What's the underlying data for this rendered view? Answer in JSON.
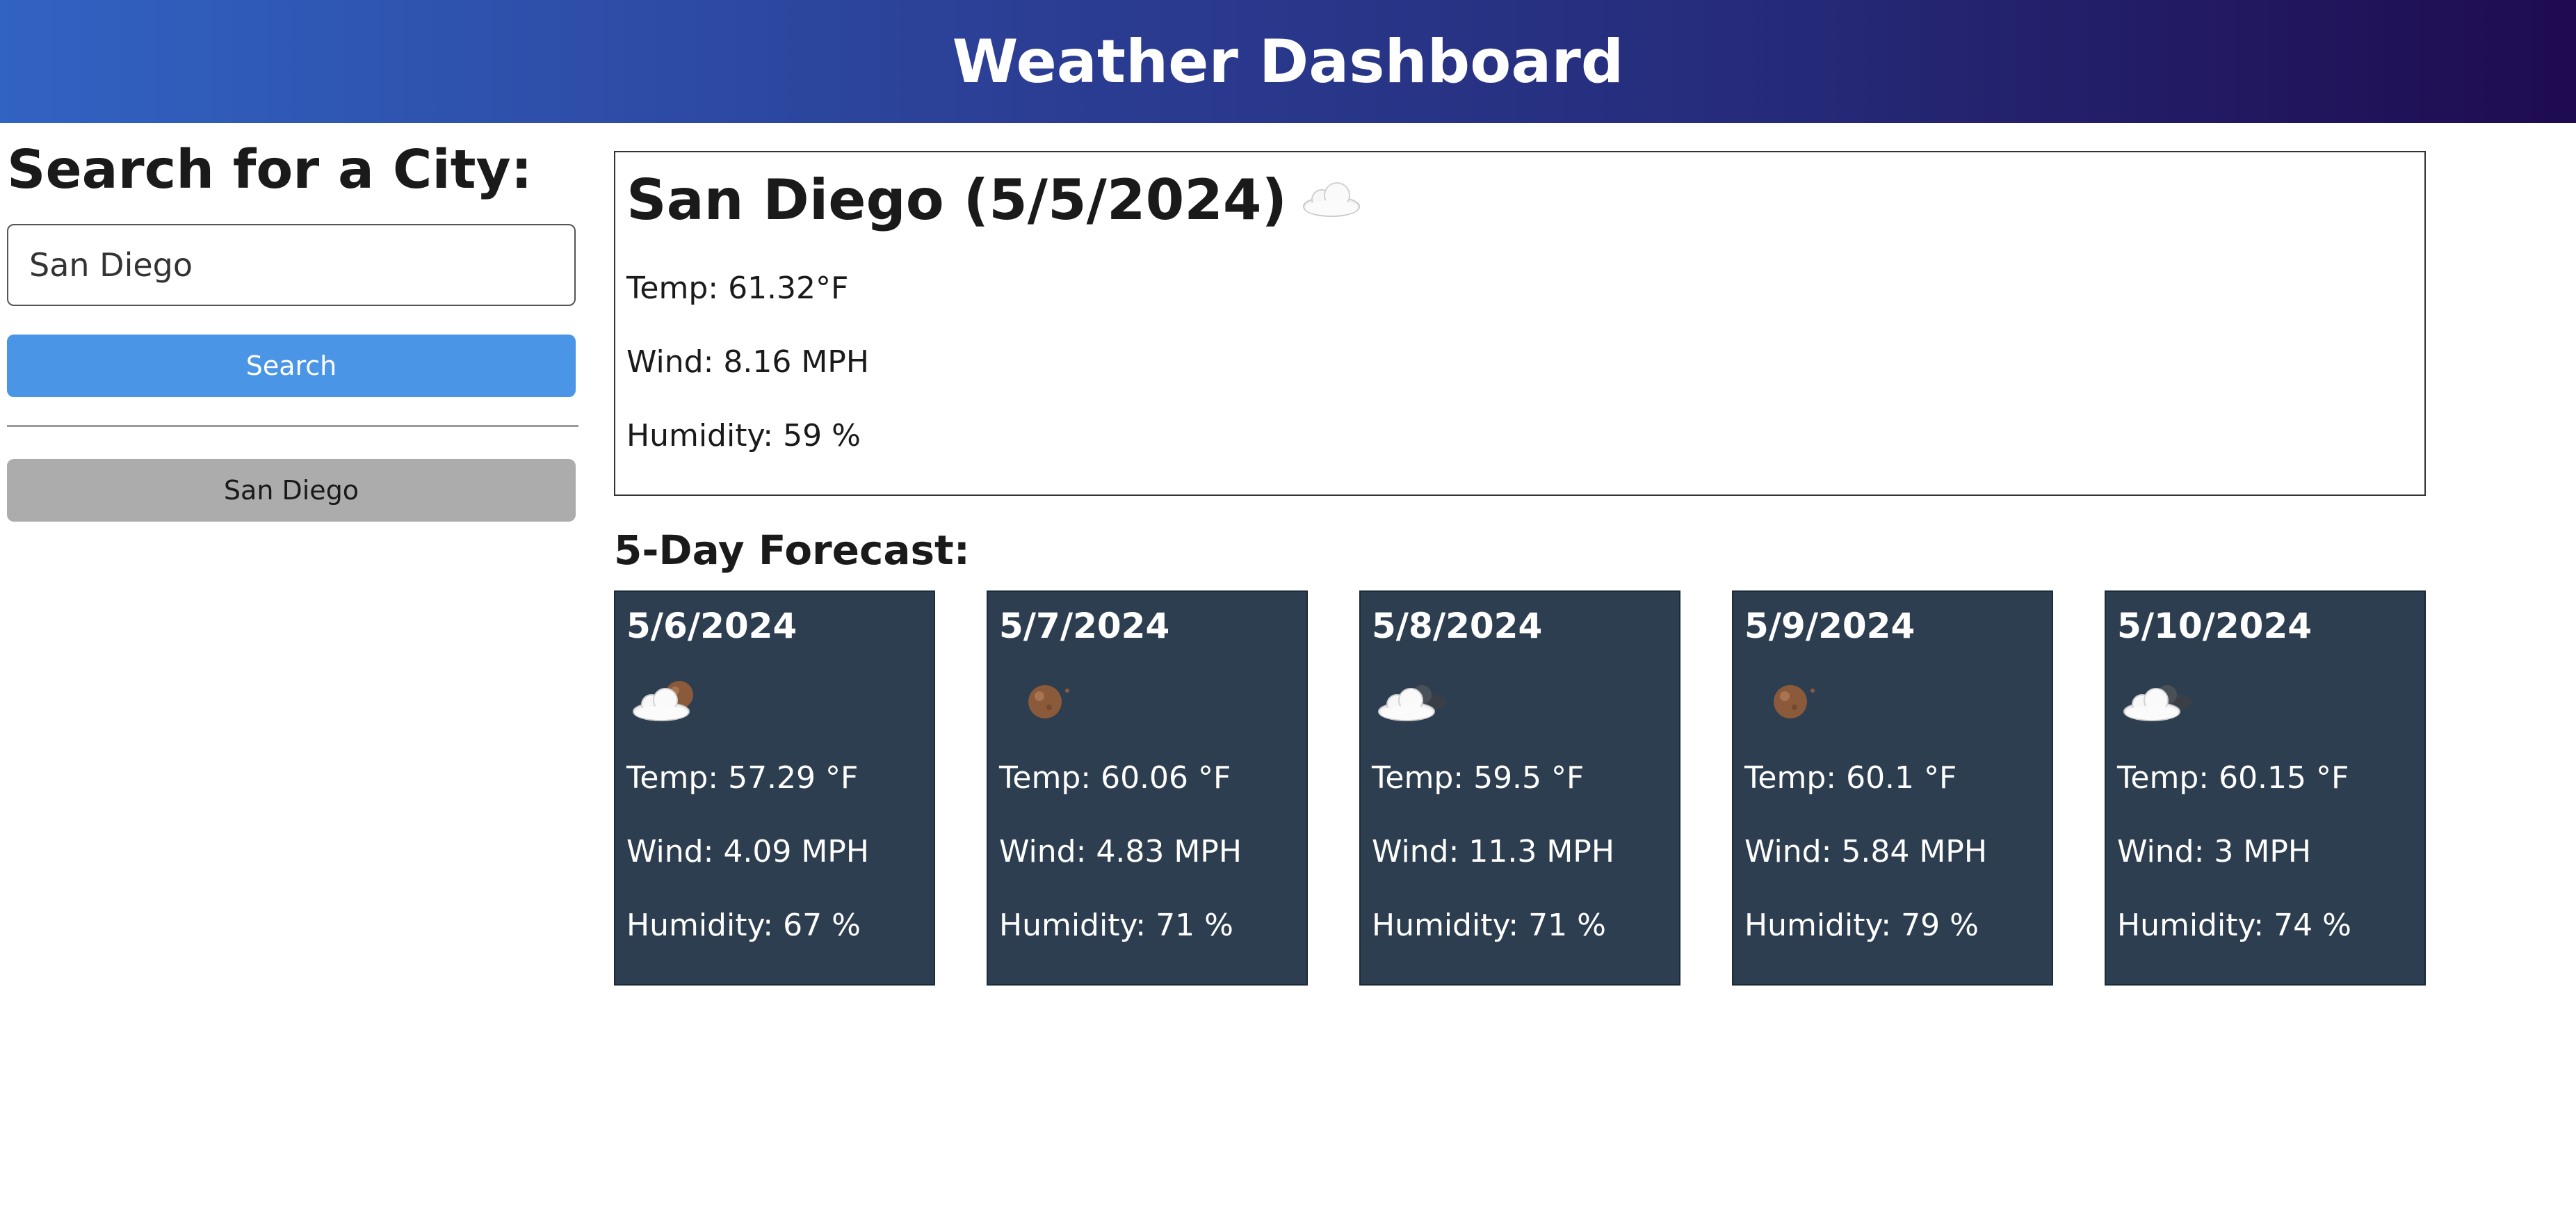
{
  "header": {
    "title": "Weather Dashboard"
  },
  "sidebar": {
    "heading": "Search for a City:",
    "search_value": "San Diego",
    "search_placeholder": "San Diego",
    "search_button": "Search",
    "history": [
      {
        "label": "San Diego"
      }
    ]
  },
  "current": {
    "title": "San Diego (5/5/2024)",
    "icon": "clouds-icon",
    "temp": "Temp: 61.32°F",
    "wind": "Wind: 8.16 MPH",
    "humidity": "Humidity: 59 %"
  },
  "forecast": {
    "heading": "5-Day Forecast:",
    "days": [
      {
        "date": "5/6/2024",
        "icon": "night-partly-cloudy-icon",
        "temp": "Temp: 57.29 °F",
        "wind": "Wind: 4.09 MPH",
        "humidity": "Humidity: 67 %"
      },
      {
        "date": "5/7/2024",
        "icon": "clear-night-icon",
        "temp": "Temp: 60.06 °F",
        "wind": "Wind: 4.83 MPH",
        "humidity": "Humidity: 71 %"
      },
      {
        "date": "5/8/2024",
        "icon": "broken-clouds-icon",
        "temp": "Temp: 59.5 °F",
        "wind": "Wind: 11.3 MPH",
        "humidity": "Humidity: 71 %"
      },
      {
        "date": "5/9/2024",
        "icon": "clear-night-icon",
        "temp": "Temp: 60.1 °F",
        "wind": "Wind: 5.84 MPH",
        "humidity": "Humidity: 79 %"
      },
      {
        "date": "5/10/2024",
        "icon": "broken-clouds-icon",
        "temp": "Temp: 60.15 °F",
        "wind": "Wind: 3 MPH",
        "humidity": "Humidity: 74 %"
      }
    ]
  },
  "colors": {
    "header_start": "#3163c3",
    "header_end": "#1f0b4f",
    "search_button": "#4a95e5",
    "history_button": "#acacac",
    "card_background": "#2d3e50"
  }
}
